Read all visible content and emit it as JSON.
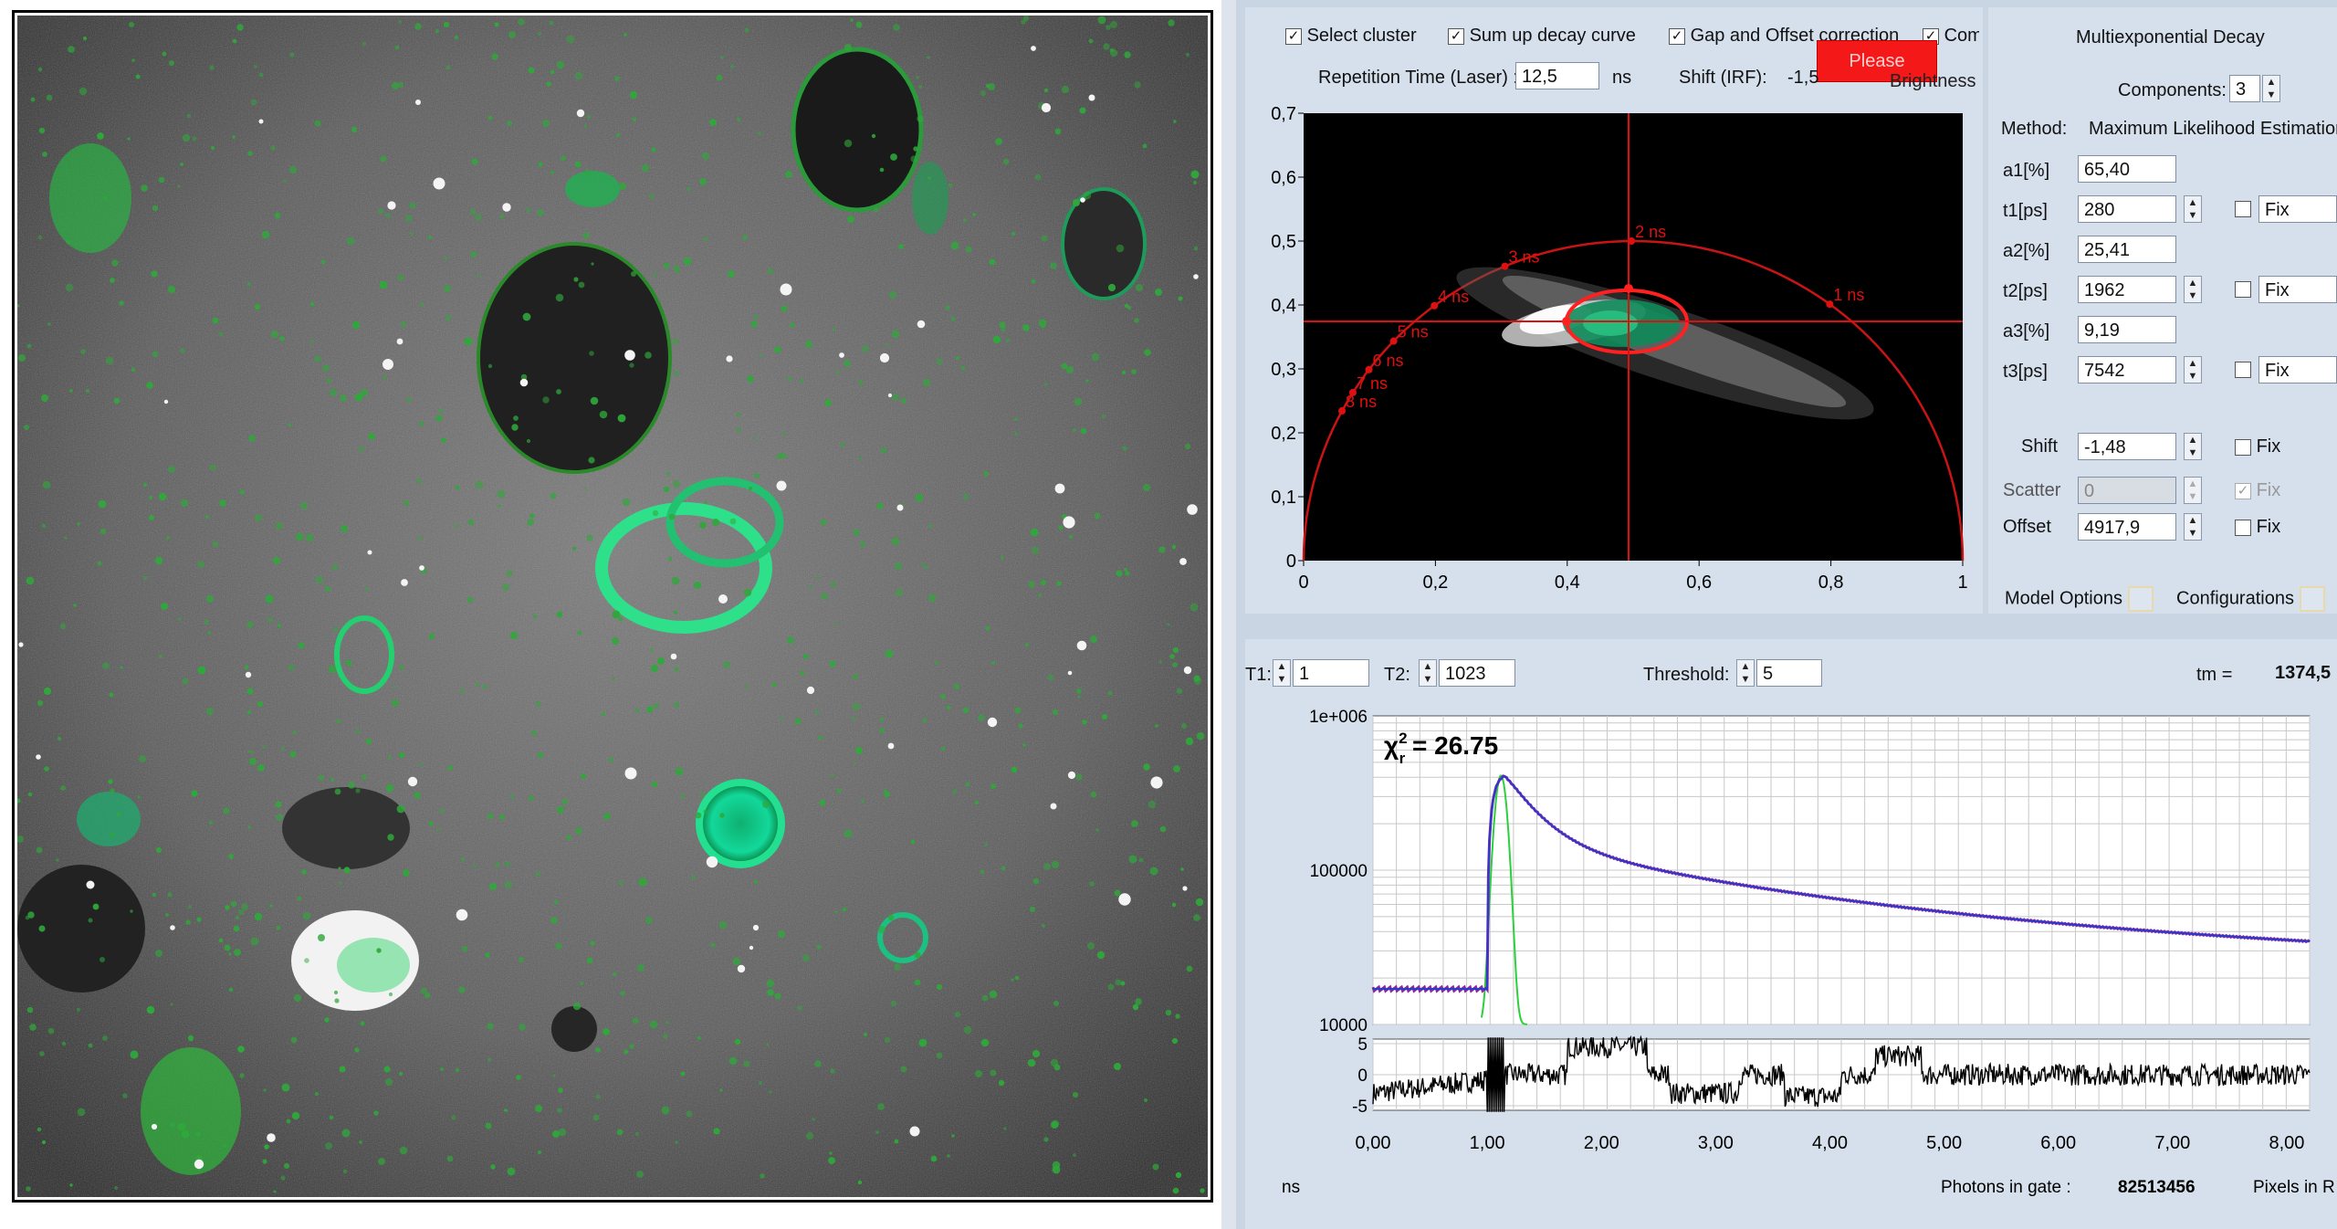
{
  "top_options": {
    "select_cluster": "Select cluster",
    "sum_up_decay": "Sum up decay curve",
    "gap_offset": "Gap and Offset correction",
    "comb": "Comb",
    "please_button": "Please",
    "repetition_label": "Repetition Time (Laser) :",
    "repetition_value": "12,5",
    "repetition_unit": "ns",
    "shift_label": "Shift  (IRF):",
    "shift_value": "-1,5",
    "brightness": "Brightness"
  },
  "phasor": {
    "y_ticks": [
      "0,7",
      "0,6",
      "0,5",
      "0,4",
      "0,3",
      "0,2",
      "0,1",
      "0"
    ],
    "x_ticks": [
      "0",
      "0,2",
      "0,4",
      "0,6",
      "0,8",
      "1"
    ],
    "lifetime_labels": [
      "8 ns",
      "7 ns",
      "6 ns",
      "5 ns",
      "4 ns",
      "3 ns",
      "2 ns",
      "1 ns"
    ]
  },
  "fit": {
    "title": "Multiexponential Decay",
    "components_label": "Components:",
    "components_value": "3",
    "method_label": "Method:",
    "method_value": "Maximum Likelihood Estimation",
    "params": [
      {
        "label": "a1[%]",
        "value": "65,40"
      },
      {
        "label": "t1[ps]",
        "value": "280",
        "fix": "Fix"
      },
      {
        "label": "a2[%]",
        "value": "25,41"
      },
      {
        "label": "t2[ps]",
        "value": "1962",
        "fix": "Fix"
      },
      {
        "label": "a3[%]",
        "value": "9,19"
      },
      {
        "label": "t3[ps]",
        "value": "7542",
        "fix": "Fix"
      }
    ],
    "shift_label": "Shift",
    "shift_value": "-1,48",
    "shift_fix": "Fix",
    "scatter_label": "Scatter",
    "scatter_value": "0",
    "scatter_fix": "Fix",
    "offset_label": "Offset",
    "offset_value": "4917,9",
    "offset_fix": "Fix",
    "model_options": "Model Options",
    "configurations": "Configurations"
  },
  "decay": {
    "t1_label": "T1:",
    "t1_value": "1",
    "t2_label": "T2:",
    "t2_value": "1023",
    "threshold_label": "Threshold:",
    "threshold_value": "5",
    "tm_label": "tm =",
    "tm_value": "1374,5",
    "chi_symbol": "χ",
    "chi_sub": "r",
    "chi_sup": "2",
    "chi_rest": " = 26.75",
    "y_ticks": [
      "1e+006",
      "100000",
      "10000"
    ],
    "res_ticks": [
      "5",
      "0",
      "-5"
    ],
    "x_ticks": [
      "0,00",
      "1,00",
      "2,00",
      "3,00",
      "4,00",
      "5,00",
      "6,00",
      "7,00",
      "8,00"
    ],
    "x_unit": "ns",
    "photons_label": "Photons in gate :",
    "photons_value": "82513456",
    "pixels_label": "Pixels in R"
  },
  "colors": {
    "accent_red": "#e01010",
    "fit_blue": "#2a3ad0",
    "irf_green": "#2ccf3c",
    "panel_bg": "#d6e0ec"
  }
}
